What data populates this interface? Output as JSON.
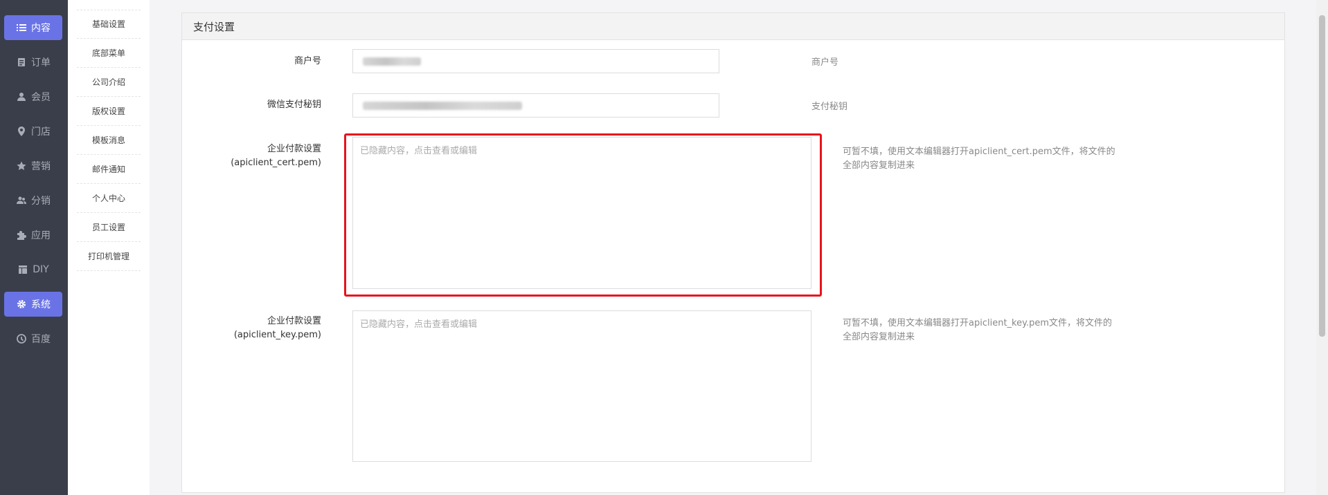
{
  "sidebar": {
    "items": [
      {
        "label": "内容",
        "icon": "list-icon",
        "active": true
      },
      {
        "label": "订单",
        "icon": "order-icon",
        "active": false
      },
      {
        "label": "会员",
        "icon": "user-icon",
        "active": false
      },
      {
        "label": "门店",
        "icon": "location-icon",
        "active": false
      },
      {
        "label": "营销",
        "icon": "star-icon",
        "active": false
      },
      {
        "label": "分销",
        "icon": "users-icon",
        "active": false
      },
      {
        "label": "应用",
        "icon": "puzzle-icon",
        "active": false
      },
      {
        "label": "DIY",
        "icon": "layout-icon",
        "active": false
      },
      {
        "label": "系统",
        "icon": "gear-icon",
        "active": true
      },
      {
        "label": "百度",
        "icon": "baidu-icon",
        "active": false
      }
    ],
    "active_color": "#6a73e6"
  },
  "subnav": {
    "items": [
      "基础设置",
      "底部菜单",
      "公司介绍",
      "版权设置",
      "模板消息",
      "邮件通知",
      "个人中心",
      "员工设置",
      "打印机管理"
    ]
  },
  "panel": {
    "title": "支付设置",
    "fields": {
      "merchant": {
        "label": "商户号",
        "hint": "商户号"
      },
      "secret": {
        "label": "微信支付秘钥",
        "hint": "支付秘钥"
      },
      "cert": {
        "label_line1": "企业付款设置",
        "label_line2": "(apiclient_cert.pem)",
        "placeholder": "已隐藏内容，点击查看或编辑",
        "hint": "可暂不填，使用文本编辑器打开apiclient_cert.pem文件，将文件的全部内容复制进来"
      },
      "key": {
        "label_line1": "企业付款设置",
        "label_line2": "(apiclient_key.pem)",
        "placeholder": "已隐藏内容，点击查看或编辑",
        "hint": "可暂不填，使用文本编辑器打开apiclient_key.pem文件，将文件的全部内容复制进来"
      }
    },
    "highlight_color": "#e8121b"
  }
}
